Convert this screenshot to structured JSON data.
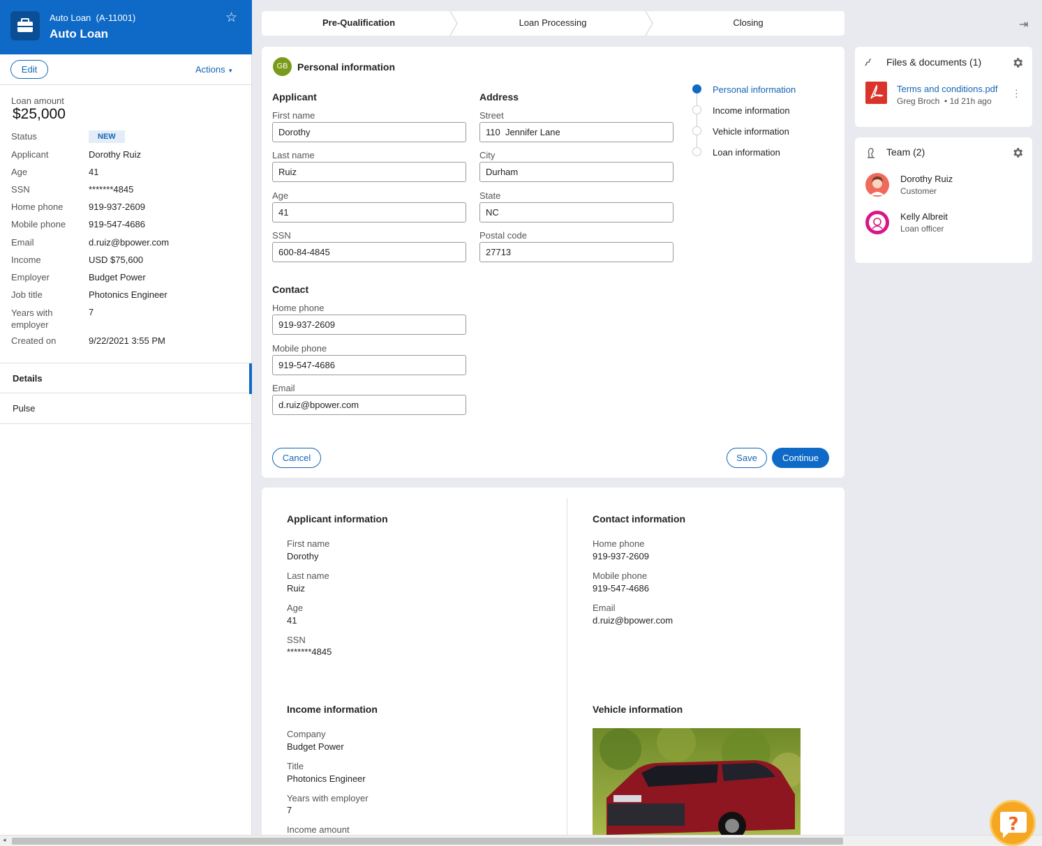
{
  "case": {
    "subtitle": "Auto Loan  (A-11001)",
    "title": "Auto Loan",
    "edit_label": "Edit",
    "actions_label": "Actions",
    "loan_amount_label": "Loan amount",
    "loan_amount": "$25,000",
    "fields": [
      {
        "label": "Status",
        "value": "NEW"
      },
      {
        "label": "Applicant",
        "value": "Dorothy Ruiz"
      },
      {
        "label": "Age",
        "value": "41"
      },
      {
        "label": "SSN",
        "value": "*******4845"
      },
      {
        "label": "Home phone",
        "value": "919-937-2609"
      },
      {
        "label": "Mobile phone",
        "value": "919-547-4686"
      },
      {
        "label": "Email",
        "value": "d.ruiz@bpower.com"
      },
      {
        "label": "Income",
        "value": "USD $75,600"
      },
      {
        "label": "Employer",
        "value": "Budget Power"
      },
      {
        "label": "Job title",
        "value": "Photonics Engineer"
      },
      {
        "label": "Years with employer",
        "value": "7"
      },
      {
        "label": "Created on",
        "value": "9/22/2021 3:55 PM"
      }
    ],
    "tabs": [
      "Details",
      "Pulse"
    ]
  },
  "stages": [
    "Pre-Qualification",
    "Loan Processing",
    "Closing"
  ],
  "form": {
    "avatar": "GB",
    "title": "Personal information",
    "applicant_heading": "Applicant",
    "address_heading": "Address",
    "contact_heading": "Contact",
    "applicant": [
      {
        "label": "First name",
        "value": "Dorothy"
      },
      {
        "label": "Last name",
        "value": "Ruiz"
      },
      {
        "label": "Age",
        "value": "41"
      },
      {
        "label": "SSN",
        "value": "600-84-4845"
      }
    ],
    "address": [
      {
        "label": "Street",
        "value": "110  Jennifer Lane"
      },
      {
        "label": "City",
        "value": "Durham"
      },
      {
        "label": "State",
        "value": "NC"
      },
      {
        "label": "Postal code",
        "value": "27713"
      }
    ],
    "contact": [
      {
        "label": "Home phone",
        "value": "919-937-2609"
      },
      {
        "label": "Mobile phone",
        "value": "919-547-4686"
      },
      {
        "label": "Email",
        "value": "d.ruiz@bpower.com"
      }
    ],
    "steps": [
      "Personal information",
      "Income information",
      "Vehicle information",
      "Loan information"
    ],
    "cancel_label": "Cancel",
    "save_label": "Save",
    "continue_label": "Continue"
  },
  "details": {
    "applicant_heading": "Applicant information",
    "applicant": [
      {
        "label": "First name",
        "value": "Dorothy"
      },
      {
        "label": "Last name",
        "value": "Ruiz"
      },
      {
        "label": "Age",
        "value": "41"
      },
      {
        "label": "SSN",
        "value": "*******4845"
      }
    ],
    "contact_heading": "Contact information",
    "contact": [
      {
        "label": "Home phone",
        "value": "919-937-2609"
      },
      {
        "label": "Mobile phone",
        "value": "919-547-4686"
      },
      {
        "label": "Email",
        "value": "d.ruiz@bpower.com"
      }
    ],
    "income_heading": "Income information",
    "income": [
      {
        "label": "Company",
        "value": "Budget Power"
      },
      {
        "label": "Title",
        "value": "Photonics Engineer"
      },
      {
        "label": "Years with employer",
        "value": "7"
      },
      {
        "label": "Income amount",
        "value": ""
      }
    ],
    "vehicle_heading": "Vehicle information"
  },
  "files": {
    "title": "Files & documents (1)",
    "file_name": "Terms and conditions.pdf",
    "file_meta": "Greg Broch  • 1d 21h ago"
  },
  "team": {
    "title": "Team (2)",
    "members": [
      {
        "name": "Dorothy Ruiz",
        "role": "Customer"
      },
      {
        "name": "Kelly Albreit",
        "role": "Loan officer"
      }
    ]
  },
  "colors": {
    "brand": "#0e6ac6",
    "link": "#1266b5",
    "help": "#f5a623"
  }
}
